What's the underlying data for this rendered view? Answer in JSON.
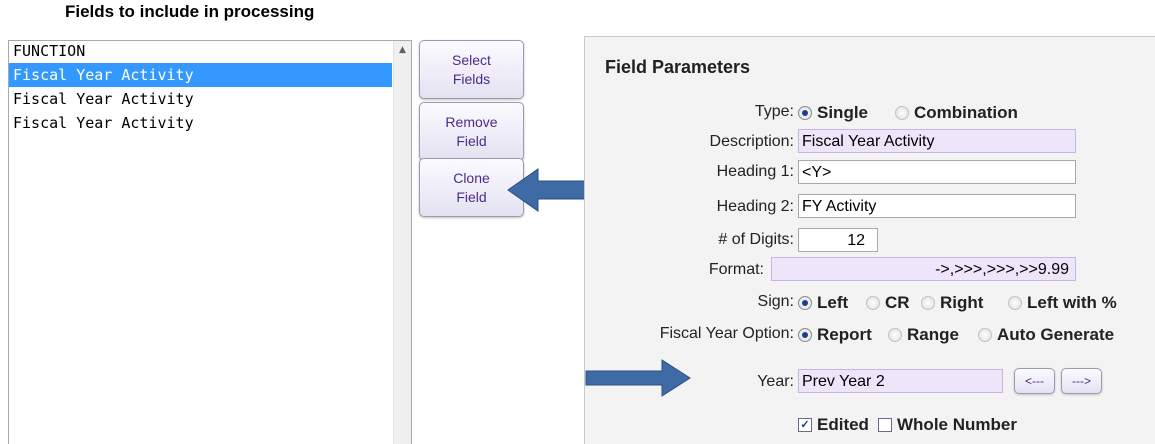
{
  "fields_title": "Fields to include in processing",
  "list": {
    "header": "FUNCTION",
    "items": [
      {
        "label": "Fiscal Year Activity",
        "selected": true
      },
      {
        "label": "Fiscal Year Activity",
        "selected": false
      },
      {
        "label": "Fiscal Year Activity",
        "selected": false
      }
    ]
  },
  "buttons": {
    "select": [
      "Select",
      "Fields"
    ],
    "remove": [
      "Remove",
      "Field"
    ],
    "clone": [
      "Clone",
      "Field"
    ]
  },
  "panel": {
    "title": "Field Parameters",
    "type_label": "Type:",
    "type_options": [
      "Single",
      "Combination"
    ],
    "type_selected": "Single",
    "description_label": "Description:",
    "description_value": "Fiscal Year Activity",
    "heading1_label": "Heading 1:",
    "heading1_value": "<Y>",
    "heading2_label": "Heading 2:",
    "heading2_value": "FY Activity",
    "digits_label": "# of Digits:",
    "digits_value": "12",
    "format_label": "Format:",
    "format_value": "->,>>>,>>>,>>9.99",
    "sign_label": "Sign:",
    "sign_options": [
      "Left",
      "CR",
      "Right",
      "Left with %"
    ],
    "sign_selected": "Left",
    "fy_label": "Fiscal Year Option:",
    "fy_options": [
      "Report",
      "Range",
      "Auto Generate"
    ],
    "fy_selected": "Report",
    "year_label": "Year:",
    "year_value": "Prev Year 2",
    "prev_button": "<---",
    "next_button": "--->",
    "edited_label": "Edited",
    "edited_checked": true,
    "whole_number_label": "Whole Number",
    "whole_number_checked": false
  },
  "colors": {
    "selection": "#3399ff",
    "arrow": "#3e6aa6",
    "button_text": "#4b2b8a",
    "input_lavender": "#ede6fa"
  },
  "icons": [
    "scroll-up-icon",
    "left-arrow-annotation-icon",
    "right-arrow-annotation-icon"
  ]
}
